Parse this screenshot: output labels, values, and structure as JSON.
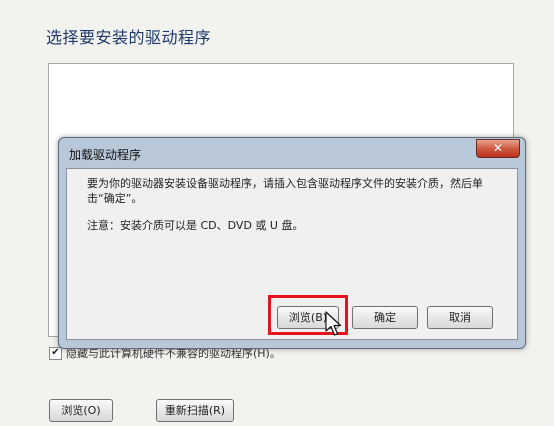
{
  "page": {
    "title": "选择要安装的驱动程序",
    "hide_incompatible_label": "隐藏与此计算机硬件不兼容的驱动程序(H)。",
    "hide_incompatible_checked": true,
    "browse_label": "浏览(O)",
    "rescan_label": "重新扫描(R)"
  },
  "dialog": {
    "title": "加载驱动程序",
    "close_glyph": "✕",
    "message": "要为你的驱动器安装设备驱动程序，请插入包含驱动程序文件的安装介质，然后单击“确定”。",
    "note": "注意：安装介质可以是 CD、DVD 或 U 盘。",
    "browse_label": "浏览(B)",
    "ok_label": "确定",
    "cancel_label": "取消"
  },
  "colors": {
    "highlight": "#e5141c",
    "title_text": "#1d3a6b",
    "close_button": "#c9462f"
  }
}
